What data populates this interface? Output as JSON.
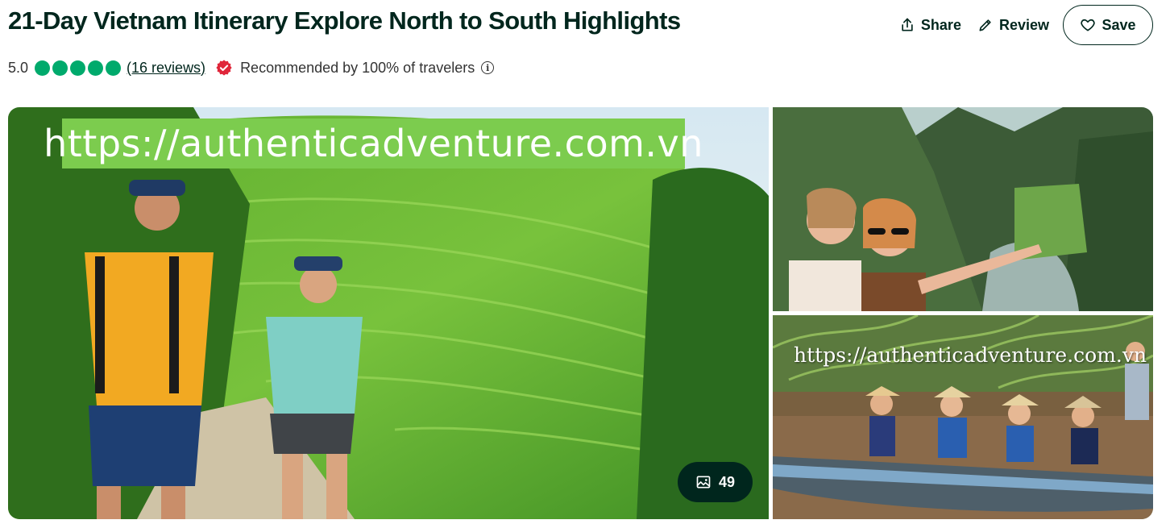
{
  "header": {
    "title": "21-Day Vietnam Itinerary Explore North to South Highlights",
    "share_label": "Share",
    "review_label": "Review",
    "save_label": "Save"
  },
  "rating": {
    "score": "5.0",
    "bubbles_filled": 5,
    "reviews_link": "(16 reviews)",
    "recommended_text": "Recommended by 100% of travelers",
    "info_glyph": "i"
  },
  "gallery": {
    "main_watermark": "https://authenticadventure.com.vn",
    "bottom_right_watermark": "https://authenticadventure.com.vn",
    "photo_count": "49"
  },
  "colors": {
    "brand_dark": "#00261d",
    "bubble_green": "#00aa6c",
    "badge_red": "#e0263a"
  },
  "icons": {
    "share": "share-icon",
    "review": "pencil-icon",
    "save": "heart-icon",
    "badge": "recommended-badge-icon",
    "info": "info-icon",
    "photos": "image-icon"
  }
}
